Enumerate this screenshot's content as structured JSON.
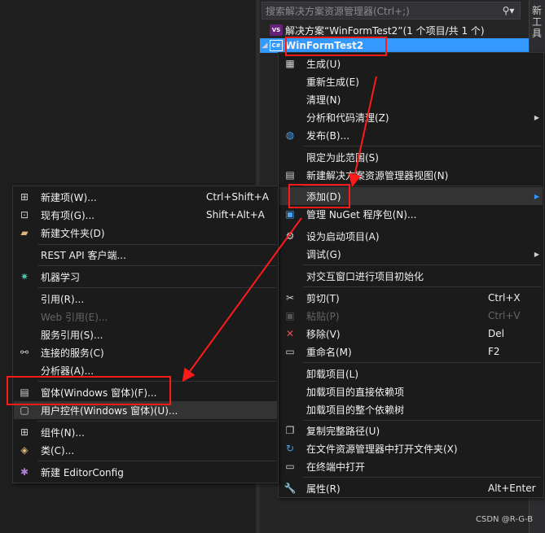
{
  "search": {
    "placeholder": "搜索解决方案资源管理器(Ctrl+;)",
    "icon": "search-icon"
  },
  "right_tab": "新工具",
  "tree": {
    "solution_label": "解决方案“WinFormTest2”(1 个项目/共 1 个)",
    "project_label": "WinFormTest2",
    "project_icon_text": "C#"
  },
  "context_menu": {
    "build": "生成(U)",
    "rebuild": "重新生成(E)",
    "clean": "清理(N)",
    "analyze": "分析和代码清理(Z)",
    "publish": "发布(B)...",
    "scope": "限定为此范围(S)",
    "new_view": "新建解决方案资源管理器视图(N)",
    "add": "添加(D)",
    "nuget": "管理 NuGet 程序包(N)...",
    "startup": "设为启动项目(A)",
    "debug": "调试(G)",
    "interactive": "对交互窗口进行项目初始化",
    "cut": "剪切(T)",
    "cut_sc": "Ctrl+X",
    "paste": "粘贴(P)",
    "paste_sc": "Ctrl+V",
    "remove": "移除(V)",
    "remove_sc": "Del",
    "rename": "重命名(M)",
    "rename_sc": "F2",
    "unload": "卸载项目(L)",
    "load_direct": "加载项目的直接依赖项",
    "load_tree": "加载项目的整个依赖树",
    "copy_path": "复制完整路径(U)",
    "open_folder": "在文件资源管理器中打开文件夹(X)",
    "terminal": "在终端中打开",
    "properties": "属性(R)",
    "properties_sc": "Alt+Enter"
  },
  "add_submenu": {
    "new_item": "新建项(W)...",
    "new_item_sc": "Ctrl+Shift+A",
    "existing_item": "现有项(G)...",
    "existing_item_sc": "Shift+Alt+A",
    "new_folder": "新建文件夹(D)",
    "rest_api": "REST API 客户端...",
    "ml": "机器学习",
    "reference": "引用(R)...",
    "web_reference": "Web 引用(E)...",
    "service_reference": "服务引用(S)...",
    "connected_service": "连接的服务(C)",
    "analyzer": "分析器(A)...",
    "form": "窗体(Windows 窗体)(F)...",
    "user_control": "用户控件(Windows 窗体)(U)...",
    "component": "组件(N)...",
    "class": "类(C)...",
    "editorconfig": "新建 EditorConfig"
  },
  "watermark": "CSDN @R-G-B",
  "colors": {
    "background": "#1e1e1e",
    "menu_bg": "#1b1b1c",
    "selection": "#3399ff",
    "highlight": "#333334",
    "annotation_red": "#ff1a1a",
    "disabled_text": "#656565"
  }
}
